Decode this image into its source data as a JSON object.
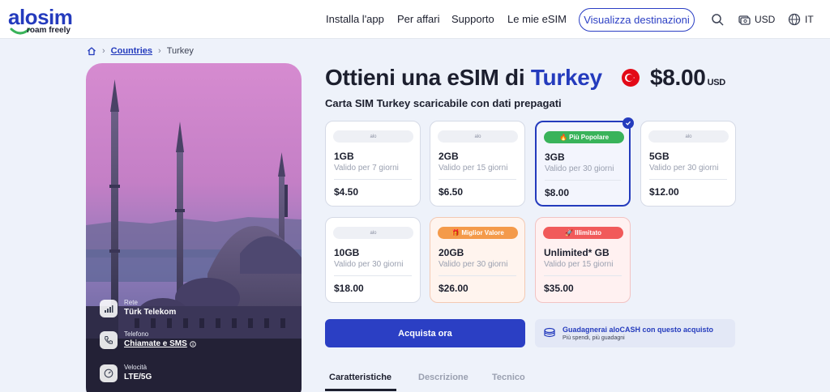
{
  "header": {
    "logo_word": "alosim",
    "logo_tagline": "roam freely",
    "nav": [
      "Installa l'app",
      "Per affari",
      "Supporto",
      "Le mie eSIM"
    ],
    "destinations_button": "Visualizza destinazioni",
    "currency": "USD",
    "language": "IT"
  },
  "breadcrumb": {
    "countries": "Countries",
    "current": "Turkey"
  },
  "product": {
    "title_prefix": "Ottieni una eSIM di",
    "country": "Turkey",
    "price": "$8.00",
    "price_currency": "USD",
    "subtitle": "Carta SIM Turkey scaricabile con dati prepagati"
  },
  "features": [
    {
      "label": "Rete",
      "value": "Türk Telekom",
      "icon": "signal-icon"
    },
    {
      "label": "Telefono",
      "value": "Chiamate e SMS",
      "icon": "phone-icon"
    },
    {
      "label": "Velocità",
      "value": "LTE/5G",
      "icon": "speed-icon"
    }
  ],
  "plans": [
    {
      "tag": "alo",
      "data": "1GB",
      "validity": "Valido per 7 giorni",
      "price": "$4.50"
    },
    {
      "tag": "alo",
      "data": "2GB",
      "validity": "Valido per 15 giorni",
      "price": "$6.50"
    },
    {
      "tag": "🔥 Più Popolare",
      "data": "3GB",
      "validity": "Valido per 30 giorni",
      "price": "$8.00",
      "selected": true
    },
    {
      "tag": "alo",
      "data": "5GB",
      "validity": "Valido per 30 giorni",
      "price": "$12.00"
    },
    {
      "tag": "alo",
      "data": "10GB",
      "validity": "Valido per 30 giorni",
      "price": "$18.00"
    },
    {
      "tag": "🎁 Miglior Valore",
      "data": "20GB",
      "validity": "Valido per 30 giorni",
      "price": "$26.00"
    },
    {
      "tag": "🚀 Illimitato",
      "data": "Unlimited* GB",
      "validity": "Valido per 15 giorni",
      "price": "$35.00"
    }
  ],
  "buy_button": "Acquista ora",
  "alocash": {
    "title": "Guadagnerai aloCASH con questo acquisto",
    "subtitle": "Più spendi, più guadagni"
  },
  "tabs": [
    "Caratteristiche",
    "Descrizione",
    "Tecnico"
  ],
  "colors": {
    "brand_blue": "#243bbd",
    "popular_green": "#39b35a",
    "value_orange": "#f49a4a",
    "unlimited_red": "#f15a5a"
  }
}
